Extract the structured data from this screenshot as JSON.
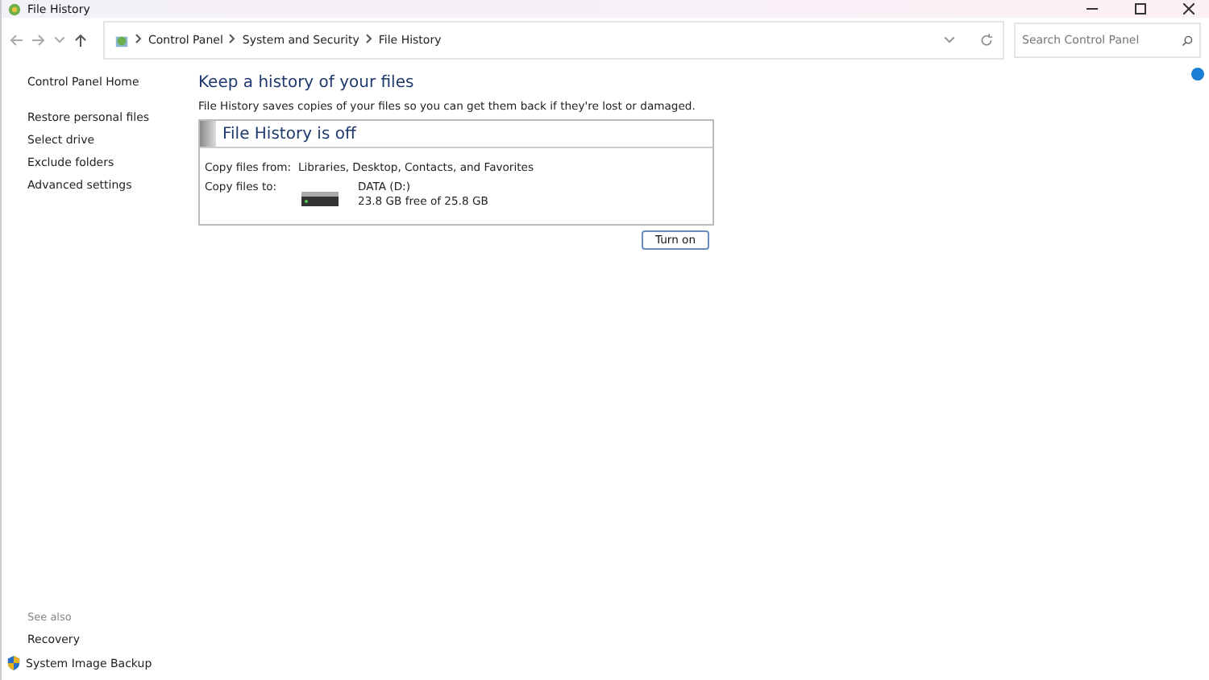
{
  "window": {
    "title": "File History"
  },
  "address_bar": {
    "breadcrumbs": [
      "Control Panel",
      "System and Security",
      "File History"
    ]
  },
  "search": {
    "placeholder": "Search Control Panel"
  },
  "sidebar": {
    "items": [
      {
        "label": "Control Panel Home"
      },
      {
        "label": "Restore personal files"
      },
      {
        "label": "Select drive"
      },
      {
        "label": "Exclude folders"
      },
      {
        "label": "Advanced settings"
      }
    ],
    "see_also": {
      "heading": "See also",
      "links": [
        {
          "label": "Recovery",
          "kind": "plain"
        },
        {
          "label": "System Image Backup",
          "kind": "shield"
        }
      ]
    }
  },
  "main": {
    "title": "Keep a history of your files",
    "description": "File History saves copies of your files so you can get them back if they're lost or damaged.",
    "status": {
      "title": "File History is off",
      "copy_from_label": "Copy files from:",
      "copy_from_value": "Libraries, Desktop, Contacts, and Favorites",
      "copy_to_label": "Copy files to:",
      "drive_name": "DATA (D:)",
      "drive_space": "23.8 GB free of 25.8 GB"
    },
    "button": "Turn on"
  }
}
